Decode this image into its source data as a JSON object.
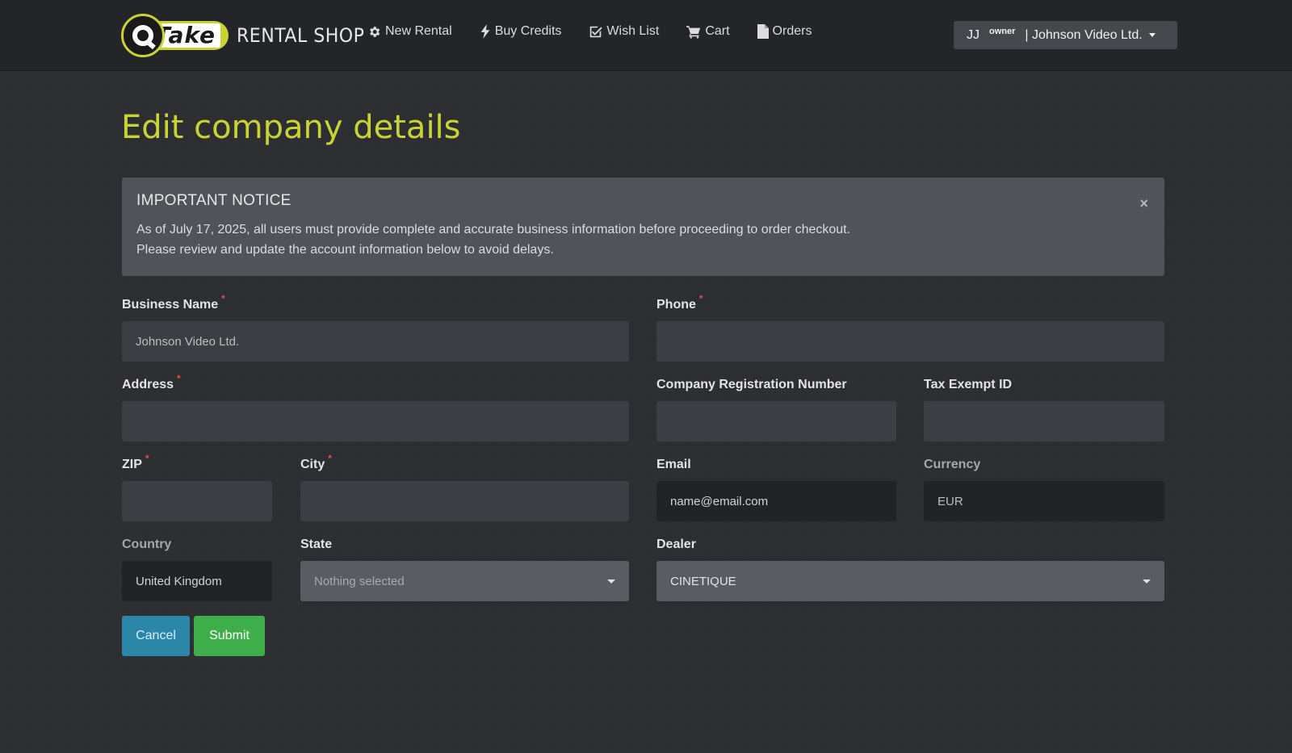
{
  "brand": {
    "logo_text": "Take",
    "title": "RENTAL SHOP"
  },
  "nav": {
    "items": [
      {
        "label": "New Rental",
        "icon": "gear-icon"
      },
      {
        "label": "Buy Credits",
        "icon": "lightning-icon"
      },
      {
        "label": "Wish List",
        "icon": "checkbox-icon"
      },
      {
        "label": "Cart",
        "icon": "cart-icon"
      },
      {
        "label": "Orders",
        "icon": "document-icon"
      }
    ]
  },
  "user_menu": {
    "initials": "JJ",
    "role": "owner",
    "company": "| Johnson Video Ltd."
  },
  "page": {
    "title": "Edit company details"
  },
  "notice": {
    "title": "IMPORTANT NOTICE",
    "line1": "As of July 17, 2025, all users must provide complete and accurate business information before proceeding to order checkout.",
    "line2": "Please review and update the account information below to avoid delays.",
    "close": "×"
  },
  "form": {
    "business_name": {
      "label": "Business Name",
      "placeholder": "Johnson Video Ltd.",
      "value": ""
    },
    "phone": {
      "label": "Phone",
      "value": ""
    },
    "address": {
      "label": "Address",
      "value": ""
    },
    "company_reg": {
      "label": "Company Registration Number",
      "value": ""
    },
    "tax_exempt": {
      "label": "Tax Exempt ID",
      "value": ""
    },
    "zip": {
      "label": "ZIP",
      "value": ""
    },
    "city": {
      "label": "City",
      "value": ""
    },
    "email": {
      "label": "Email",
      "value": "name@email.com"
    },
    "currency": {
      "label": "Currency",
      "value": "EUR"
    },
    "country": {
      "label": "Country",
      "value": "United Kingdom"
    },
    "state": {
      "label": "State",
      "value": "Nothing selected"
    },
    "dealer": {
      "label": "Dealer",
      "value": "CINETIQUE"
    },
    "required_mark": "*"
  },
  "buttons": {
    "cancel": "Cancel",
    "submit": "Submit"
  },
  "colors": {
    "accent": "#c9d434",
    "submit": "#3dae4a",
    "cancel": "#2b86a8",
    "required": "#d9534f"
  }
}
